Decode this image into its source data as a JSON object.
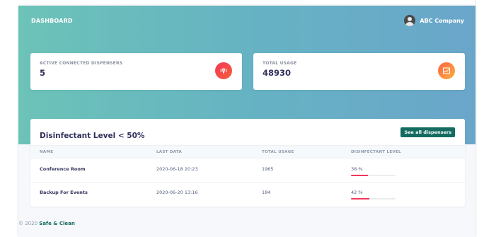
{
  "header": {
    "brand": "DASHBOARD",
    "company": "ABC Company"
  },
  "stats": [
    {
      "label": "ACTIVE CONNECTED DISPENSERS",
      "value": "5",
      "icon": "wifi-icon"
    },
    {
      "label": "TOTAL USAGE",
      "value": "48930",
      "icon": "chart-icon"
    }
  ],
  "table": {
    "title": "Disinfectant Level < 50%",
    "button": "See all dispensers",
    "columns": [
      "NAME",
      "LAST DATA",
      "TOTAL USAGE",
      "DISINFECTANT LEVEL"
    ],
    "rows": [
      {
        "name": "Conference Room",
        "last_data": "2020-06-18 20:23",
        "usage": "1965",
        "level_text": "38 %",
        "level": 0.38
      },
      {
        "name": "Backup For Events",
        "last_data": "2020-06-20 13:16",
        "usage": "184",
        "level_text": "42 %",
        "level": 0.42
      }
    ]
  },
  "footer": {
    "copyright": "© 2020",
    "brand": "Safe & Clean"
  },
  "colors": {
    "accent": "#146b61",
    "progress": "#f5365c"
  }
}
